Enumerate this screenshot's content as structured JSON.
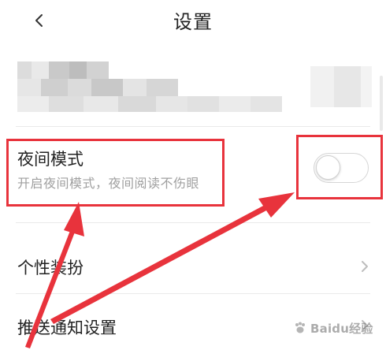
{
  "header": {
    "title": "设置",
    "back_icon": "chevron-left-icon"
  },
  "night_mode": {
    "title": "夜间模式",
    "subtitle": "开启夜间模式，夜间阅读不伤眼",
    "toggle_on": false
  },
  "menu": [
    {
      "label": "个性装扮"
    },
    {
      "label": "推送通知设置"
    }
  ],
  "watermark": {
    "text": "Baidu经验"
  },
  "colors": {
    "annotation": "#e8333c",
    "subtitle": "#a0a0a0",
    "divider": "#eaeaea"
  }
}
